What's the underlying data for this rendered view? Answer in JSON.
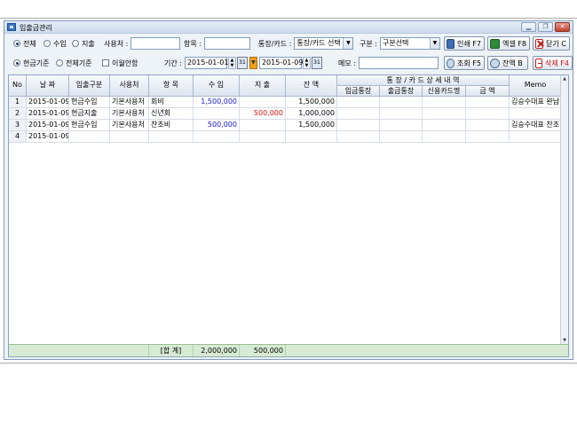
{
  "window": {
    "title": "입출금관리"
  },
  "filters": {
    "type_all": "전체",
    "type_income": "수입",
    "type_expense": "지출",
    "user_label": "사용처 :",
    "user_value": "",
    "item_label": "항목 :",
    "item_value": "",
    "account_label": "통장/카드 :",
    "account_select": "통장/카드 선택",
    "category_label": "구분 :",
    "category_select": "구분선택",
    "basis_cash": "현금기준",
    "basis_all": "전체기준",
    "carryover_label": "이월안함",
    "period_label": "기간 :",
    "date_from": "2015-01-01",
    "date_to": "2015-01-09",
    "memo_label": "메모 :",
    "memo_value": ""
  },
  "buttons": {
    "print": "인쇄 F7",
    "excel": "엑셀 F8",
    "close": "닫기 C",
    "search": "조회 F5",
    "balance": "잔액 B",
    "delete": "삭제 F4"
  },
  "grid": {
    "headers": {
      "no": "No",
      "date": "날 짜",
      "type": "입출구분",
      "user": "사용처",
      "item": "항 목",
      "income": "수 입",
      "expense": "지 출",
      "balance": "잔 액",
      "detail_group": "통 장 / 카 드   상 세 내 역",
      "in_account": "입금통장",
      "out_account": "출금통장",
      "card_name": "신용카드명",
      "amount": "금 액",
      "memo": "Memo"
    },
    "rows": [
      {
        "no": "1",
        "date": "2015-01-09",
        "type": "현금수입",
        "user": "기본사용처",
        "item": "회비",
        "income": "1,500,000",
        "expense": "",
        "balance": "1,500,000",
        "in_account": "",
        "out_account": "",
        "card_name": "",
        "amount": "",
        "memo": "김승수대표 완납"
      },
      {
        "no": "2",
        "date": "2015-01-09",
        "type": "현금지출",
        "user": "기본사용처",
        "item": "신년회",
        "income": "",
        "expense": "500,000",
        "balance": "1,000,000",
        "in_account": "",
        "out_account": "",
        "card_name": "",
        "amount": "",
        "memo": ""
      },
      {
        "no": "3",
        "date": "2015-01-09",
        "type": "현금수입",
        "user": "기본사용처",
        "item": "찬조비",
        "income": "500,000",
        "expense": "",
        "balance": "1,500,000",
        "in_account": "",
        "out_account": "",
        "card_name": "",
        "amount": "",
        "memo": "김승수대표 찬조"
      },
      {
        "no": "4",
        "date": "2015-01-09",
        "type": "",
        "user": "",
        "item": "",
        "income": "",
        "expense": "",
        "balance": "",
        "in_account": "",
        "out_account": "",
        "card_name": "",
        "amount": "",
        "memo": ""
      }
    ],
    "totals": {
      "label": "[합 계]",
      "income": "2,000,000",
      "expense": "500,000"
    }
  },
  "colors": {
    "income": "#1414d8",
    "expense": "#d01010",
    "total_row": "#d7ebd4"
  }
}
